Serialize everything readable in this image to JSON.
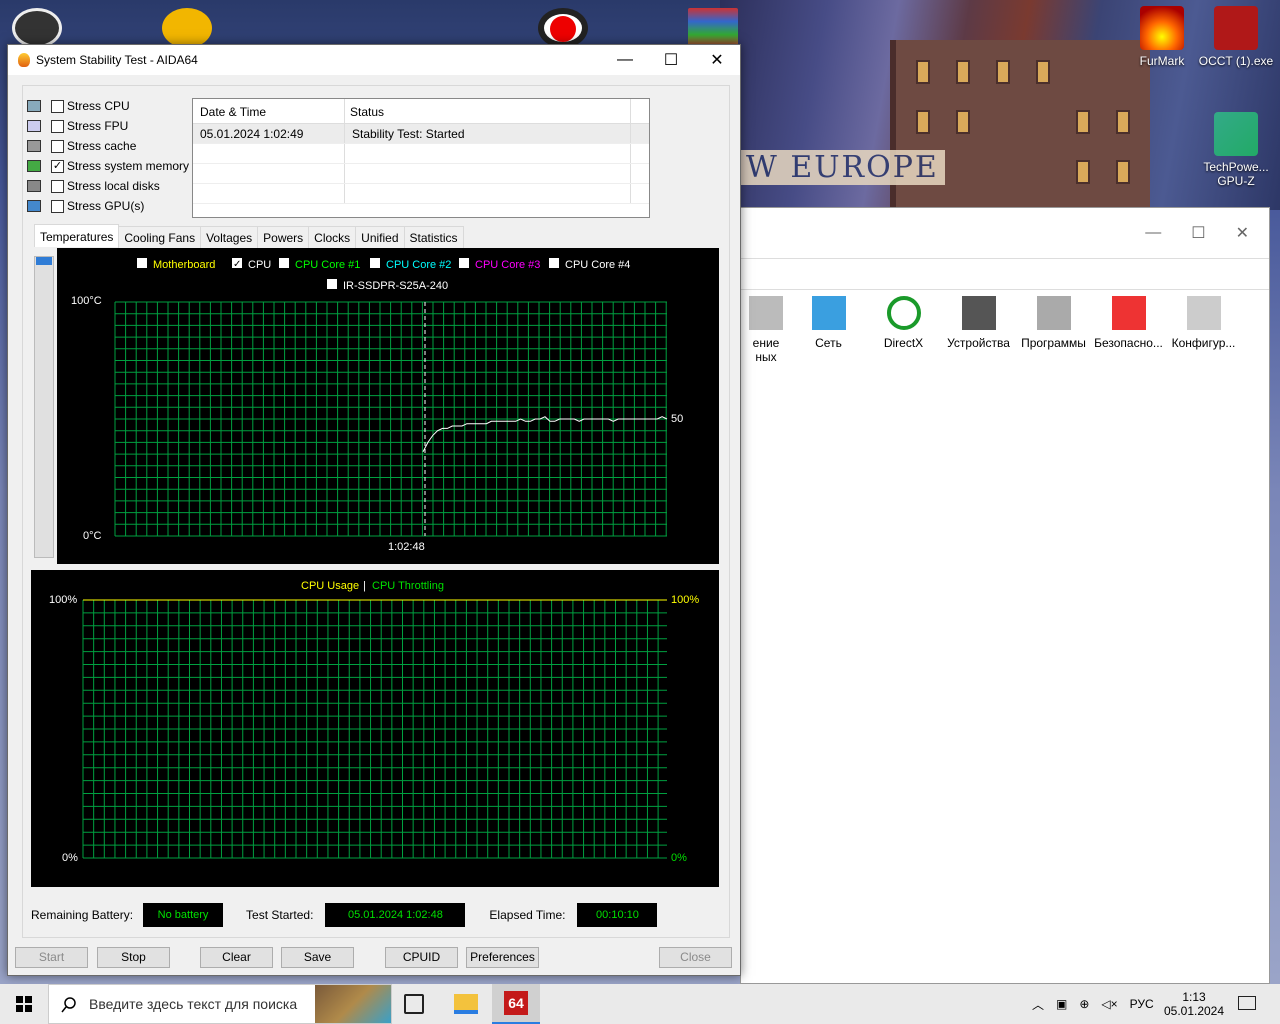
{
  "window": {
    "title": "System Stability Test - AIDA64",
    "minimize": "—",
    "maximize": "☐",
    "close": "✕"
  },
  "stress_options": [
    {
      "label": "Stress CPU",
      "checked": false,
      "icon": "cpu-icon"
    },
    {
      "label": "Stress FPU",
      "checked": false,
      "icon": "fpu-icon"
    },
    {
      "label": "Stress cache",
      "checked": false,
      "icon": "cache-icon"
    },
    {
      "label": "Stress system memory",
      "checked": true,
      "icon": "memory-icon"
    },
    {
      "label": "Stress local disks",
      "checked": false,
      "icon": "disk-icon"
    },
    {
      "label": "Stress GPU(s)",
      "checked": false,
      "icon": "gpu-icon"
    }
  ],
  "status_table": {
    "headers": [
      "Date & Time",
      "Status"
    ],
    "rows": [
      [
        "05.01.2024 1:02:49",
        "Stability Test: Started"
      ]
    ]
  },
  "tabs": [
    "Temperatures",
    "Cooling Fans",
    "Voltages",
    "Powers",
    "Clocks",
    "Unified",
    "Statistics"
  ],
  "active_tab": "Temperatures",
  "chart_data": [
    {
      "type": "line",
      "legend": [
        {
          "name": "Motherboard",
          "checked": false,
          "color": "#ffff00"
        },
        {
          "name": "CPU",
          "checked": true,
          "color": "#ffffff"
        },
        {
          "name": "CPU Core #1",
          "checked": false,
          "color": "#00ff00"
        },
        {
          "name": "CPU Core #2",
          "checked": false,
          "color": "#00ffff"
        },
        {
          "name": "CPU Core #3",
          "checked": false,
          "color": "#ff00ff"
        },
        {
          "name": "CPU Core #4",
          "checked": false,
          "color": "#ffffff"
        },
        {
          "name": "IR-SSDPR-S25A-240",
          "checked": false,
          "color": "#ffffff"
        }
      ],
      "y_top_label": "100°C",
      "y_bottom_label": "0°C",
      "ylim": [
        0,
        100
      ],
      "x_marker_label": "1:02:48",
      "last_value_label": "50",
      "series": [
        {
          "name": "CPU",
          "values": [
            36,
            40,
            43,
            45,
            46,
            46,
            47,
            47,
            47,
            48,
            48,
            48,
            48,
            48,
            49,
            49,
            49,
            49,
            49,
            49,
            50,
            49,
            49,
            50,
            50,
            51,
            49,
            49,
            50,
            50,
            50,
            50,
            49,
            50,
            50,
            50,
            50,
            50,
            50,
            49,
            50,
            50,
            50,
            50,
            50,
            50,
            50,
            50,
            50,
            51,
            50
          ]
        }
      ],
      "grid": true,
      "grid_color": "#00a040"
    },
    {
      "type": "line",
      "legend": [
        {
          "name": "CPU Usage",
          "color": "#ffff00"
        },
        {
          "name": "CPU Throttling",
          "color": "#00e000"
        }
      ],
      "separator": "|",
      "y_left_top": "100%",
      "y_left_bottom": "0%",
      "y_right_top": "100%",
      "y_right_bottom": "0%",
      "ylim": [
        0,
        100
      ],
      "grid": true,
      "grid_color": "#00a040"
    }
  ],
  "bottom_info": {
    "battery_label": "Remaining Battery:",
    "battery_value": "No battery",
    "started_label": "Test Started:",
    "started_value": "05.01.2024 1:02:48",
    "elapsed_label": "Elapsed Time:",
    "elapsed_value": "00:10:10"
  },
  "buttons": {
    "start": "Start",
    "stop": "Stop",
    "clear": "Clear",
    "save": "Save",
    "cpuid": "CPUID",
    "preferences": "Preferences",
    "close": "Close"
  },
  "desktop": {
    "icons": [
      {
        "label": "FurMark",
        "icon": "furmark-icon"
      },
      {
        "label": "OCCT (1).exe",
        "icon": "occt-icon"
      },
      {
        "label": "TechPowe... GPU-Z",
        "icon": "gpuz-icon"
      }
    ],
    "wallpaper_sign": "W EUROPE"
  },
  "bg_window": {
    "items": [
      {
        "label": "ение\nных",
        "icon": "storage-icon"
      },
      {
        "label": "Сеть",
        "icon": "network-icon"
      },
      {
        "label": "DirectX",
        "icon": "xbox-icon"
      },
      {
        "label": "Устройства",
        "icon": "devices-icon"
      },
      {
        "label": "Программы",
        "icon": "programs-icon"
      },
      {
        "label": "Безопасно...",
        "icon": "shield-icon"
      },
      {
        "label": "Конфигур...",
        "icon": "config-icon"
      }
    ]
  },
  "taskbar": {
    "search_placeholder": "Введите здесь текст для поиска",
    "lang": "РУС",
    "time": "1:13",
    "date": "05.01.2024",
    "aida_badge": "64"
  }
}
